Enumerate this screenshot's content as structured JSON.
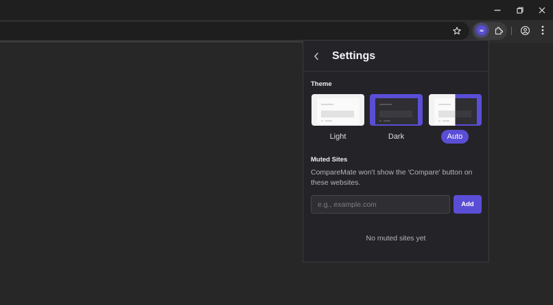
{
  "window": {
    "minimize_icon": "minimize-icon",
    "restore_icon": "restore-icon",
    "close_icon": "close-icon"
  },
  "toolbar": {
    "bookmark_icon": "star-icon",
    "extension_icon_text": "∞",
    "extensions_icon": "puzzle-icon",
    "profile_icon": "profile-icon",
    "menu_icon": "kebab-menu-icon"
  },
  "popup": {
    "title": "Settings",
    "back_icon": "chevron-left-icon",
    "theme": {
      "label": "Theme",
      "options": [
        {
          "label": "Light",
          "selected": false
        },
        {
          "label": "Dark",
          "selected": false
        },
        {
          "label": "Auto",
          "selected": true
        }
      ]
    },
    "muted_sites": {
      "label": "Muted Sites",
      "description": "CompareMate won't show the 'Compare' button on these websites.",
      "input_value": "",
      "input_placeholder": "e.g., example.com",
      "add_label": "Add",
      "empty_message": "No muted sites yet"
    }
  },
  "colors": {
    "accent": "#5b4ed6",
    "popup_bg": "#242428",
    "page_bg": "#272727"
  }
}
